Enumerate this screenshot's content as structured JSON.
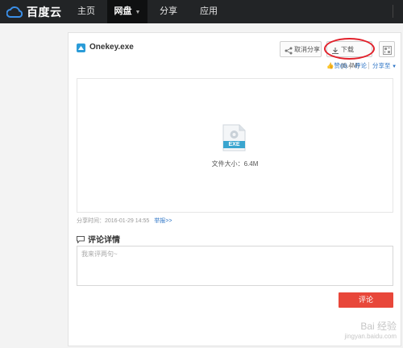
{
  "nav": {
    "logo_text": "百度云",
    "items": [
      {
        "label": "主页"
      },
      {
        "label": "网盘"
      },
      {
        "label": "分享"
      },
      {
        "label": "应用"
      }
    ]
  },
  "file": {
    "name": "Onekey.exe",
    "type_label": "EXE",
    "size_text": "文件大小：6.4M",
    "share_time": "分享时间：2016-01-29 14:55",
    "report_label": "举报>>"
  },
  "actions": {
    "cancel_share": "取消分享",
    "download": "下载(6.4M)",
    "like": "赞(0)",
    "comment": "评论",
    "share_to": "分享至"
  },
  "comments": {
    "title": "评论详情",
    "placeholder": "我来评两句~",
    "submit": "评论"
  },
  "watermark": {
    "text": "Bai 经验",
    "url": "jingyan.baidu.com"
  },
  "colors": {
    "topbar": "#222426",
    "link": "#2d74c6",
    "submit": "#e8473a",
    "highlight": "#e2202a",
    "exe_badge": "#3aa5cf"
  }
}
